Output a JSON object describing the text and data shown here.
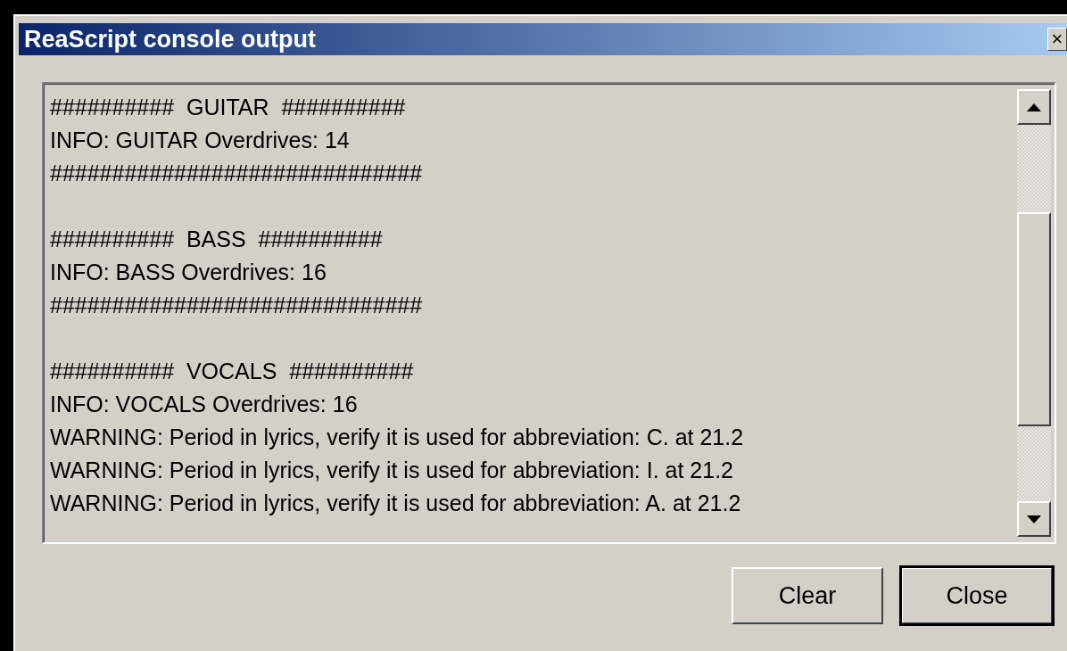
{
  "window": {
    "title": "ReaScript console output",
    "close_glyph": "×"
  },
  "console": {
    "blocks": [
      [
        "##########  GUITAR  ##########",
        "INFO: GUITAR Overdrives: 14",
        "##############################"
      ],
      [
        "##########  BASS  ##########",
        "INFO: BASS Overdrives: 16",
        "##############################"
      ],
      [
        "##########  VOCALS  ##########",
        "INFO: VOCALS Overdrives: 16",
        "WARNING: Period in lyrics, verify it is used for abbreviation: C. at 21.2",
        "WARNING: Period in lyrics, verify it is used for abbreviation: I. at 21.2",
        "WARNING: Period in lyrics, verify it is used for abbreviation: A. at 21.2"
      ]
    ]
  },
  "buttons": [
    {
      "label": "Clear",
      "default": false
    },
    {
      "label": "Close",
      "default": true
    }
  ]
}
